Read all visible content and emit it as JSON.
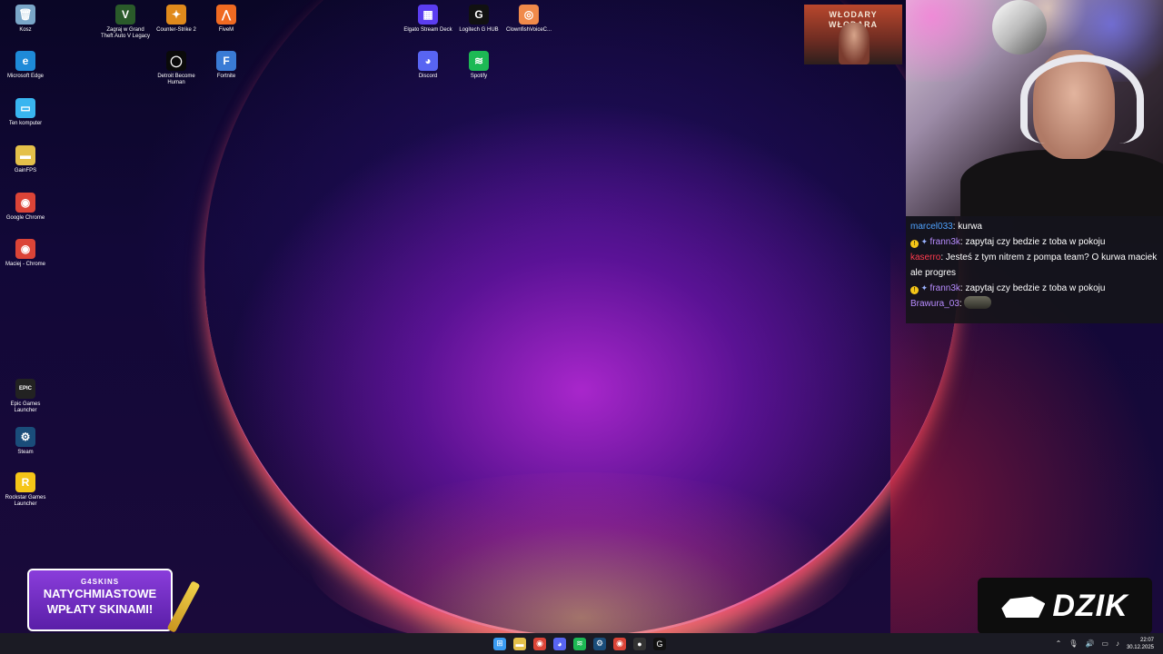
{
  "desktop_icons": [
    {
      "label": "Kosz",
      "icon": "recycle-bin-icon",
      "color": "#7aa6c8",
      "glyph": "🗑"
    },
    {
      "label": "Microsoft Edge",
      "icon": "edge-icon",
      "color": "#1e8ad8",
      "glyph": "e"
    },
    {
      "label": "Ten komputer",
      "icon": "computer-icon",
      "color": "#39b5f0",
      "glyph": "▭"
    },
    {
      "label": "GainFPS",
      "icon": "folder-icon",
      "color": "#e4c04a",
      "glyph": "▬"
    },
    {
      "label": "Google Chrome",
      "icon": "chrome-icon",
      "color": "#db4437",
      "glyph": "◉"
    },
    {
      "label": "Maciej - Chrome",
      "icon": "chrome-profile-icon",
      "color": "#db4437",
      "glyph": "◉"
    },
    {
      "label": "Epic Games Launcher",
      "icon": "epic-games-icon",
      "color": "#222222",
      "glyph": "EPIC"
    },
    {
      "label": "Steam",
      "icon": "steam-icon",
      "color": "#1a4d7a",
      "glyph": "⚙"
    },
    {
      "label": "Rockstar Games Launcher",
      "icon": "rockstar-icon",
      "color": "#f5c518",
      "glyph": "R"
    },
    {
      "label": "Zagraj w Grand Theft Auto V Legacy",
      "icon": "gta-icon",
      "color": "#2a5a2a",
      "glyph": "V"
    },
    {
      "label": "Counter-Strike 2",
      "icon": "cs2-icon",
      "color": "#e08a1c",
      "glyph": "✦"
    },
    {
      "label": "FiveM",
      "icon": "fivem-icon",
      "color": "#f06a22",
      "glyph": "⋀"
    },
    {
      "label": "Detroit Become Human",
      "icon": "detroit-icon",
      "color": "#0a0a0a",
      "glyph": "◯"
    },
    {
      "label": "Fortnite",
      "icon": "fortnite-icon",
      "color": "#3a7bd5",
      "glyph": "F"
    },
    {
      "label": "Elgato Stream Deck",
      "icon": "stream-deck-icon",
      "color": "#5b3df0",
      "glyph": "▦"
    },
    {
      "label": "Logitech G HUB",
      "icon": "logitech-icon",
      "color": "#111111",
      "glyph": "G"
    },
    {
      "label": "ClownfishVoiceC...",
      "icon": "clownfish-icon",
      "color": "#f08a4a",
      "glyph": "◎"
    },
    {
      "label": "Discord",
      "icon": "discord-icon",
      "color": "#5865f2",
      "glyph": "◕"
    },
    {
      "label": "Spotify",
      "icon": "spotify-icon",
      "color": "#1db954",
      "glyph": "≋"
    }
  ],
  "sponsor": {
    "line1": "WŁODARY",
    "line2": "WŁODARA"
  },
  "chat": [
    {
      "user": "marcel033",
      "color": "#4fa3ff",
      "text": ": kurwa",
      "badges": false,
      "emote": false
    },
    {
      "user": "frann3k",
      "color": "#b88cff",
      "text": ": zapytaj czy bedzie z toba w pokoju",
      "badges": true,
      "emote": false
    },
    {
      "user": "kaserro",
      "color": "#ff3b4e",
      "text": ": Jesteś z tym nitrem z pompa team? O kurwa maciek ale progres",
      "badges": false,
      "emote": false
    },
    {
      "user": "frann3k",
      "color": "#b88cff",
      "text": ": zapytaj czy bedzie z toba w pokoju",
      "badges": true,
      "emote": false
    },
    {
      "user": "Brawura_03",
      "color": "#b88cff",
      "text": ":",
      "badges": false,
      "emote": true
    }
  ],
  "banner": {
    "brand": "G4SKINS",
    "line1": "NATYCHMIASTOWE",
    "line2": "WPŁATY SKINAMI!"
  },
  "dzik": {
    "word": "DZIK"
  },
  "taskbar": {
    "apps": [
      {
        "icon": "windows-start-icon",
        "color": "#3a9bf0",
        "glyph": "⊞"
      },
      {
        "icon": "file-explorer-icon",
        "color": "#e4c04a",
        "glyph": "▬"
      },
      {
        "icon": "chrome-icon",
        "color": "#db4437",
        "glyph": "◉"
      },
      {
        "icon": "discord-icon",
        "color": "#5865f2",
        "glyph": "◕"
      },
      {
        "icon": "spotify-icon",
        "color": "#1db954",
        "glyph": "≋"
      },
      {
        "icon": "steam-icon",
        "color": "#1a4d7a",
        "glyph": "⚙"
      },
      {
        "icon": "chrome-profile-icon",
        "color": "#db4437",
        "glyph": "◉"
      },
      {
        "icon": "obs-icon",
        "color": "#333333",
        "glyph": "●"
      },
      {
        "icon": "logitech-icon",
        "color": "#111111",
        "glyph": "G"
      }
    ],
    "time": "22:07",
    "date": "30.12.2025"
  }
}
